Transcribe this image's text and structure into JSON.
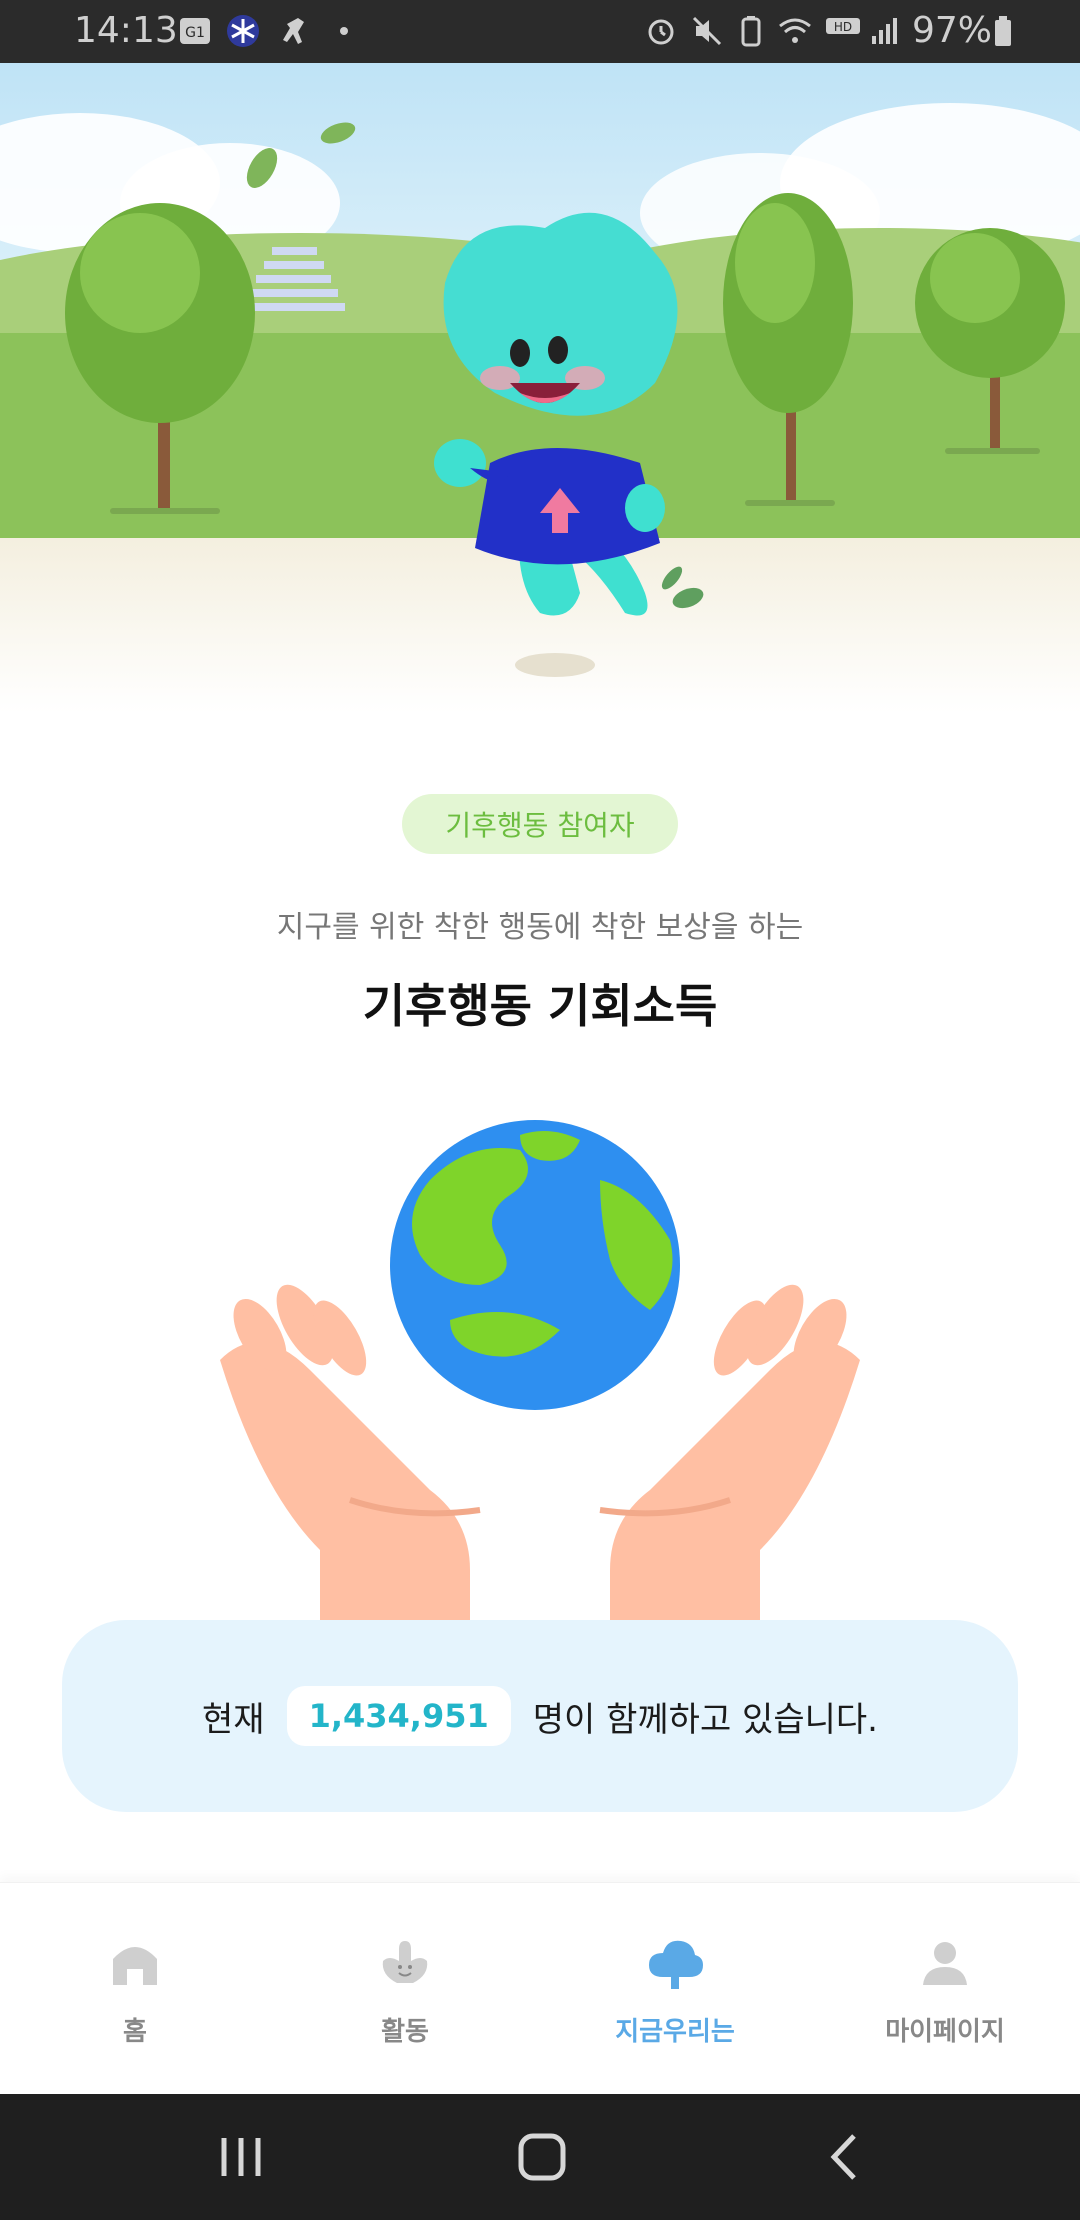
{
  "status_bar": {
    "time": "14:13",
    "battery_percent": "97%",
    "icons": [
      "g1-icon",
      "snowflake-icon",
      "runner-icon",
      "dot-icon",
      "alarm-icon",
      "mute-icon",
      "battery-saver-icon",
      "wifi-icon",
      "hd-voice-icon",
      "signal-icon",
      "battery-icon"
    ]
  },
  "hero": {
    "illustration": "mascot-running-in-park"
  },
  "badge": {
    "label": "기후행동 참여자"
  },
  "subtitle": "지구를 위한 착한 행동에 착한 보상을 하는",
  "title": "기후행동 기회소득",
  "illustration": "hands-holding-earth",
  "counter": {
    "prefix": "현재",
    "value": "1,434,951",
    "suffix": "명이 함께하고 있습니다."
  },
  "bottom_nav": {
    "items": [
      {
        "label": "홈",
        "icon": "home-icon",
        "active": false
      },
      {
        "label": "활동",
        "icon": "activity-icon",
        "active": false
      },
      {
        "label": "지금우리는",
        "icon": "cloud-icon",
        "active": true
      },
      {
        "label": "마이페이지",
        "icon": "person-icon",
        "active": false
      }
    ]
  },
  "colors": {
    "accent": "#5aa9e6",
    "badge_text": "#6cbd3f",
    "badge_bg": "#e3f6d3",
    "counter_value": "#23b5c9",
    "counter_bg": "#e5f4fd"
  }
}
